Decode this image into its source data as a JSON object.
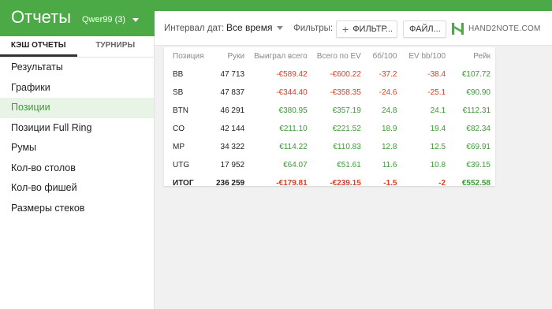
{
  "header": {
    "title": "Отчеты",
    "player": "Qwer99 (3)"
  },
  "sidebar": {
    "tabs": [
      {
        "label": "КЭШ ОТЧЕТЫ",
        "active": true
      },
      {
        "label": "ТУРНИРЫ",
        "active": false
      }
    ],
    "items": [
      {
        "label": "Результаты"
      },
      {
        "label": "Графики"
      },
      {
        "label": "Позиции",
        "active": true
      },
      {
        "label": "Позиции Full Ring"
      },
      {
        "label": "Румы"
      },
      {
        "label": "Кол-во столов"
      },
      {
        "label": "Кол-во фишей"
      },
      {
        "label": "Размеры стеков"
      }
    ]
  },
  "filters": {
    "date_label": "Интервал дат:",
    "date_value": "Все время",
    "filters_label": "Фильтры:",
    "filter_button": "ФИЛЬТР...",
    "files_button": "ФАЙЛ...",
    "logo_text": "HAND2NOTE.COM"
  },
  "table": {
    "columns": [
      "Позиция",
      "Руки",
      "Выиграл всего",
      "Всего по EV",
      "бб/100",
      "EV bb/100",
      "Рейк"
    ],
    "rows": [
      [
        "BB",
        "47 713",
        "-€589.42",
        "-€600.22",
        "-37.2",
        "-38.4",
        "€107.72"
      ],
      [
        "SB",
        "47 837",
        "-€344.40",
        "-€358.35",
        "-24.6",
        "-25.1",
        "€90.90"
      ],
      [
        "BTN",
        "46 291",
        "€380.95",
        "€357.19",
        "24.8",
        "24.1",
        "€112.31"
      ],
      [
        "CO",
        "42 144",
        "€211.10",
        "€221.52",
        "18.9",
        "19.4",
        "€82.34"
      ],
      [
        "MP",
        "34 322",
        "€114.22",
        "€110.83",
        "12.8",
        "12.5",
        "€69.91"
      ],
      [
        "UTG",
        "17 952",
        "€64.07",
        "€51.61",
        "11.6",
        "10.8",
        "€39.15"
      ]
    ],
    "total": [
      "ИТОГ",
      "236 259",
      "-€179.81",
      "-€239.15",
      "-1.5",
      "-2",
      "€552.58"
    ]
  },
  "colors": {
    "brand_green": "#4caa46",
    "positive": "#3d9a37",
    "negative": "#d9402a"
  }
}
